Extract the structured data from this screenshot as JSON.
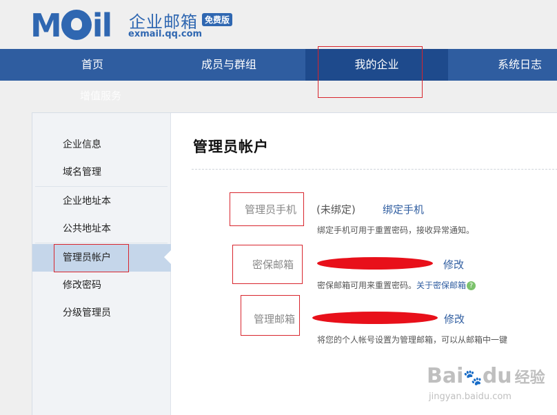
{
  "header": {
    "logo_text_cn": "企业邮箱",
    "logo_badge": "免费版",
    "logo_domain": "exmail.qq.com"
  },
  "nav": {
    "items": [
      {
        "label": "首页"
      },
      {
        "label": "成员与群组"
      },
      {
        "label": "我的企业"
      },
      {
        "label": "系统日志"
      }
    ],
    "extra": "增值服务"
  },
  "sidebar": {
    "items": [
      {
        "label": "企业信息"
      },
      {
        "label": "域名管理"
      },
      {
        "label": "企业地址本"
      },
      {
        "label": "公共地址本"
      },
      {
        "label": "管理员帐户"
      },
      {
        "label": "修改密码"
      },
      {
        "label": "分级管理员"
      }
    ]
  },
  "main": {
    "title": "管理员帐户",
    "phone": {
      "label": "管理员手机",
      "status": "(未绑定)",
      "action": "绑定手机",
      "hint": "绑定手机可用于重置密码，接收异常通知。"
    },
    "secure_mail": {
      "label": "密保邮箱",
      "action": "修改",
      "hint": "密保邮箱可用来重置密码。",
      "hint_link": "关于密保邮箱"
    },
    "admin_mail": {
      "label": "管理邮箱",
      "action": "修改",
      "hint": "将您的个人帐号设置为管理邮箱，可以从邮箱中一键"
    }
  },
  "watermark": {
    "brand": "Bai",
    "brand2": "du",
    "brand_cn": "经验",
    "url": "jingyan.baidu.com"
  },
  "colors": {
    "brand": "#2f67b1",
    "nav": "#2f5da0",
    "nav_active": "#1e4a8c",
    "sidebar_active": "#c5d6ea",
    "annotation": "#d8242c",
    "redaction": "#e8101a"
  }
}
